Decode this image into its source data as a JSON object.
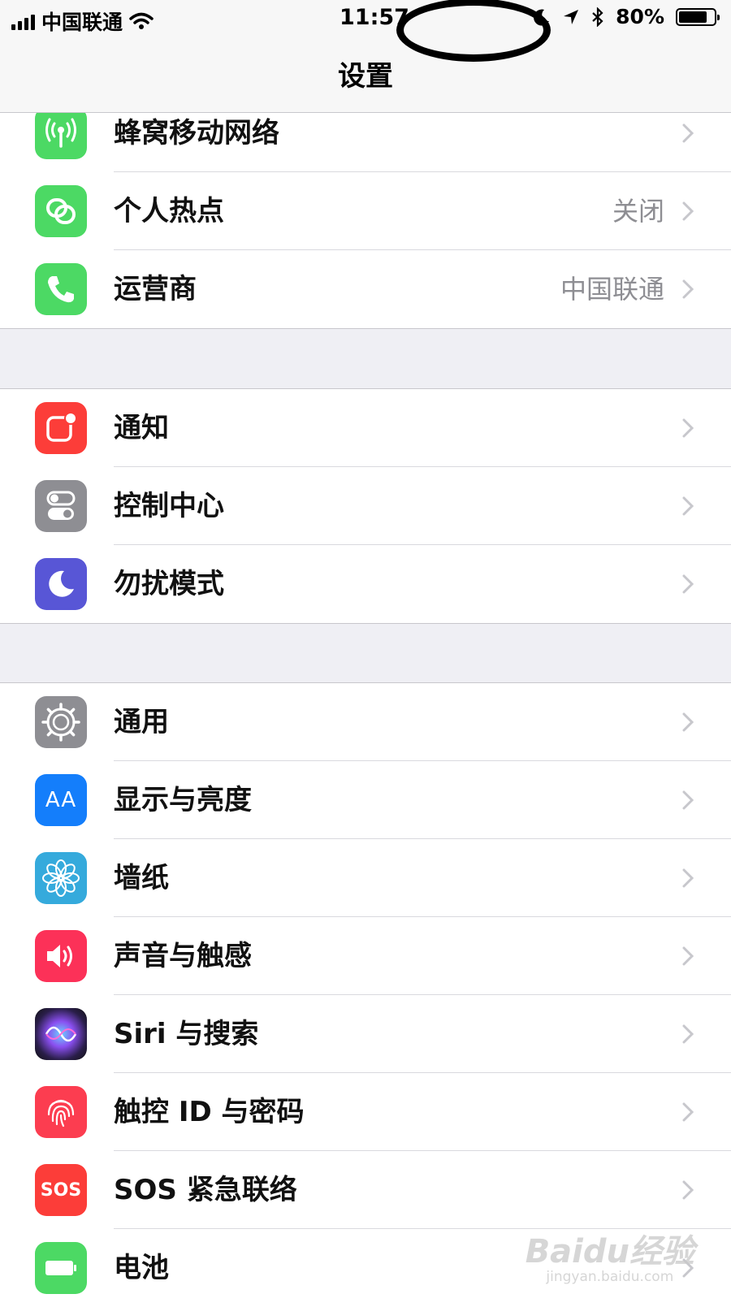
{
  "status_bar": {
    "carrier": "中国联通",
    "time": "11:57",
    "battery_percent": "80%",
    "battery_level": 0.8
  },
  "nav": {
    "title": "设置"
  },
  "groups": [
    {
      "items": [
        {
          "label": "蜂窝移动网络",
          "detail": "",
          "icon": "cellular-antenna-icon",
          "color": "#4cd964"
        },
        {
          "label": "个人热点",
          "detail": "关闭",
          "icon": "hotspot-link-icon",
          "color": "#4cd964"
        },
        {
          "label": "运营商",
          "detail": "中国联通",
          "icon": "phone-icon",
          "color": "#4cd964"
        }
      ]
    },
    {
      "items": [
        {
          "label": "通知",
          "detail": "",
          "icon": "notification-icon",
          "color": "#fc3d39"
        },
        {
          "label": "控制中心",
          "detail": "",
          "icon": "control-center-icon",
          "color": "#8e8e93"
        },
        {
          "label": "勿扰模式",
          "detail": "",
          "icon": "moon-icon",
          "color": "#5856d6"
        }
      ]
    },
    {
      "items": [
        {
          "label": "通用",
          "detail": "",
          "icon": "gear-icon",
          "color": "#8e8e93"
        },
        {
          "label": "显示与亮度",
          "detail": "",
          "icon": "text-size-icon",
          "color": "#147efb"
        },
        {
          "label": "墙纸",
          "detail": "",
          "icon": "flower-icon",
          "color": "#35aadc"
        },
        {
          "label": "声音与触感",
          "detail": "",
          "icon": "speaker-icon",
          "color": "#fc3158"
        },
        {
          "label": "Siri 与搜索",
          "detail": "",
          "icon": "siri-icon",
          "color": "#222244"
        },
        {
          "label": "触控 ID 与密码",
          "detail": "",
          "icon": "fingerprint-icon",
          "color": "#fc3d50"
        },
        {
          "label": "SOS 紧急联络",
          "detail": "",
          "icon": "sos-icon",
          "color": "#fc3d39"
        },
        {
          "label": "电池",
          "detail": "",
          "icon": "battery-icon",
          "color": "#4cd964"
        }
      ]
    }
  ],
  "icon_text": {
    "text_size": "AA",
    "sos": "SOS"
  },
  "watermark": {
    "logo": "Baidu经验",
    "url": "jingyan.baidu.com"
  }
}
